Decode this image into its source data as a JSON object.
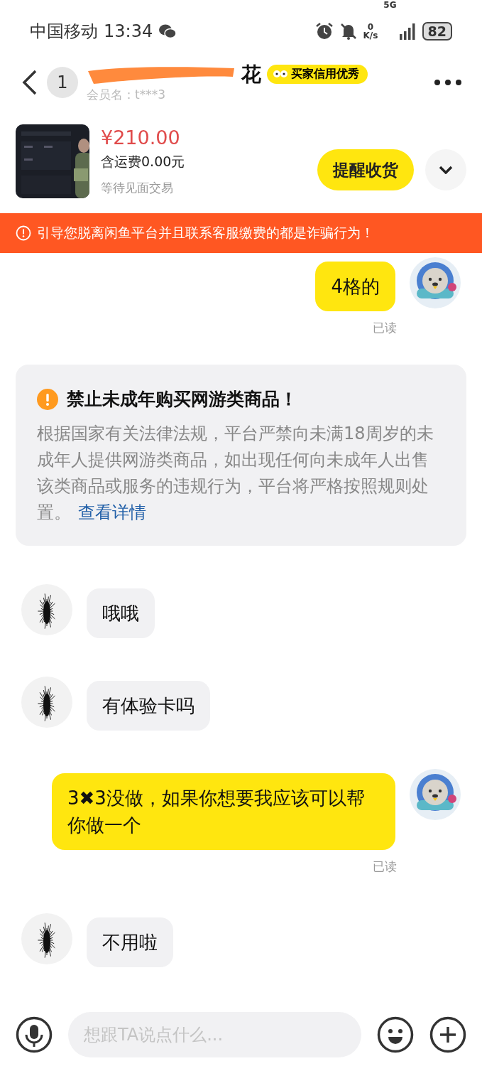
{
  "status_bar": {
    "carrier": "中国移动",
    "time": "13:34",
    "net_speed_value": "0",
    "net_speed_unit": "K/s",
    "network": "5G",
    "battery": "82"
  },
  "header": {
    "unread": "1",
    "title_visible": "花",
    "badge": "买家信用优秀",
    "member": "会员名：t***3"
  },
  "product": {
    "kind": "picture",
    "price": "¥210.00",
    "shipping": "含运费0.00元",
    "status": "等待见面交易",
    "action": "提醒收货"
  },
  "warning": "引导您脱离闲鱼平台并且联系客服缴费的都是诈骗行为！",
  "messages": [
    {
      "kind": "out",
      "text": "4格的",
      "read": "已读"
    },
    {
      "kind": "notice",
      "title": "禁止未成年购买网游类商品！",
      "body": "根据国家有关法律法规，平台严禁向未满18周岁的未成年人提供网游类商品，如出现任何向未成年人出售该类商品或服务的违规行为，平台将严格按照规则处置。",
      "link": "查看详情"
    },
    {
      "kind": "in",
      "text": "哦哦"
    },
    {
      "kind": "in",
      "text": "有体验卡吗"
    },
    {
      "kind": "out",
      "text": "3✖3没做，如果你想要我应该可以帮你做一个",
      "read": "已读"
    },
    {
      "kind": "in",
      "text": "不用啦"
    }
  ],
  "input": {
    "placeholder": "想跟TA说点什么..."
  }
}
